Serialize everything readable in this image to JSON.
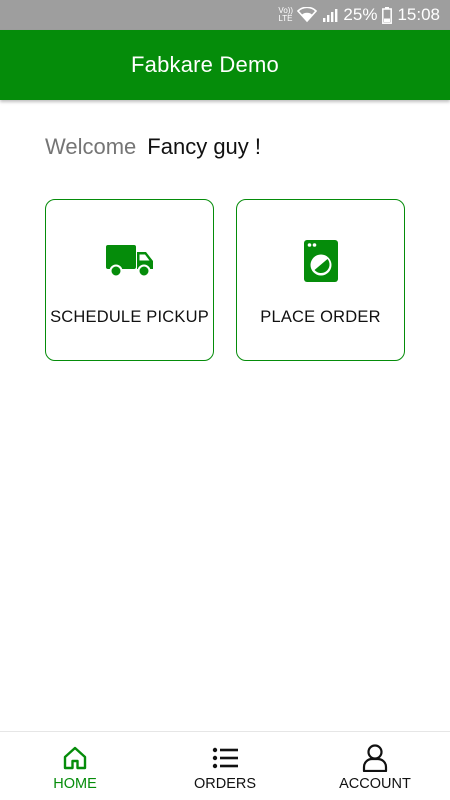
{
  "status_bar": {
    "volte": "Vo)) LTE",
    "battery_percent": "25%",
    "time": "15:08"
  },
  "app_bar": {
    "title": "Fabkare Demo",
    "color": "#058c0a"
  },
  "welcome": {
    "label": "Welcome",
    "name": "Fancy guy !"
  },
  "actions": [
    {
      "label": "SCHEDULE PICKUP",
      "icon": "truck-icon"
    },
    {
      "label": "PLACE ORDER",
      "icon": "washing-machine-icon"
    }
  ],
  "bottom_nav": {
    "active": "HOME",
    "items": [
      {
        "label": "HOME",
        "icon": "home-icon"
      },
      {
        "label": "ORDERS",
        "icon": "list-icon"
      },
      {
        "label": "ACCOUNT",
        "icon": "user-icon"
      }
    ]
  }
}
